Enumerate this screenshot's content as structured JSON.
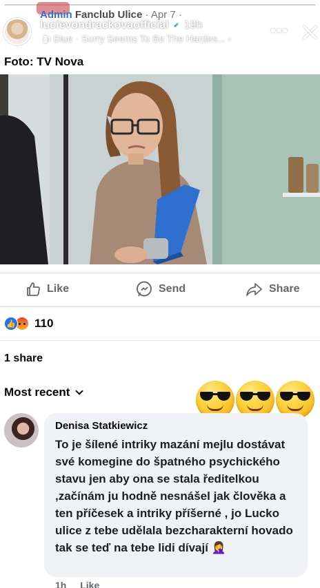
{
  "story": {
    "admin_label": "Admin",
    "group_name": "Fanclub Ulice",
    "post_date": "· Apr 7 ·",
    "username": "lucievondrackovaofficial",
    "age": "19h",
    "music": "Blue · Sorry Seems To Be The Hardes... ›",
    "more_icon": "more-horizontal-icon",
    "close_icon": "close-icon"
  },
  "post": {
    "caption": "Foto: TV Nova",
    "actions": {
      "like": "Like",
      "send": "Send",
      "share": "Share"
    },
    "reaction_count": "110",
    "shares": "1 share",
    "sort_label": "Most recent"
  },
  "comment": {
    "author": "Denisa Statkiewicz",
    "text": "To je šílené intriky mazání mejlu dostávat své komegine do špatného psychického stavu jen aby ona se stala ředitelkou ,začínám ju hodně nesnášel jak člověka a ten příčesek a intriky příšerné , jo Lucko ulice z tebe udělala bezcharakterní hovado tak  se teď na tebe lidi dívají 🤦‍♀️",
    "time": "1h",
    "like_label": "Like"
  },
  "colors": {
    "facebook_blue": "#1877f2",
    "meta_gray": "#65676b",
    "bubble_bg": "#f0f2f5"
  }
}
